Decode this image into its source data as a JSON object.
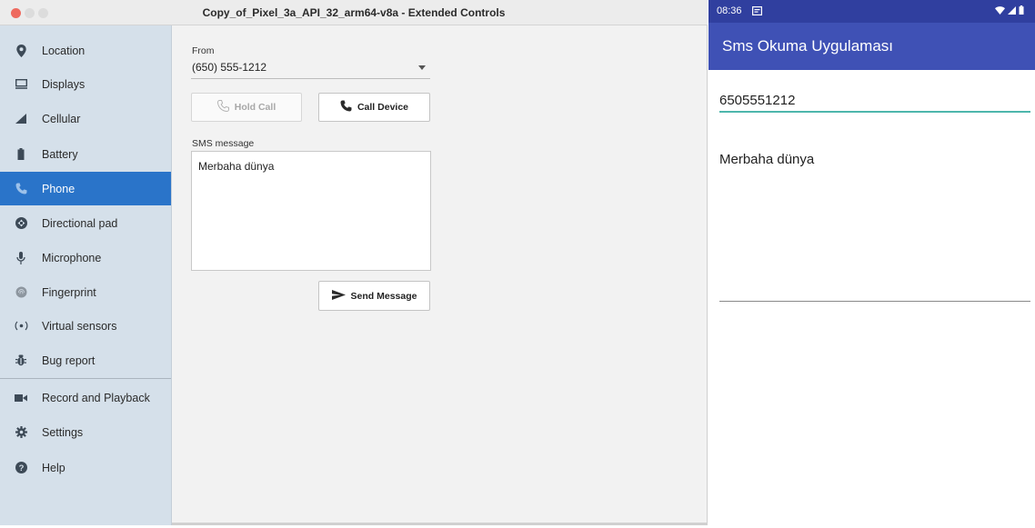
{
  "window": {
    "title": "Copy_of_Pixel_3a_API_32_arm64-v8a - Extended Controls"
  },
  "sidebar": {
    "items": [
      {
        "label": "Location",
        "icon": "location-pin-icon"
      },
      {
        "label": "Displays",
        "icon": "display-icon"
      },
      {
        "label": "Cellular",
        "icon": "cellular-signal-icon"
      },
      {
        "label": "Battery",
        "icon": "battery-icon"
      },
      {
        "label": "Phone",
        "icon": "phone-icon",
        "active": true
      },
      {
        "label": "Directional pad",
        "icon": "dpad-icon"
      },
      {
        "label": "Microphone",
        "icon": "microphone-icon"
      },
      {
        "label": "Fingerprint",
        "icon": "fingerprint-icon"
      },
      {
        "label": "Virtual sensors",
        "icon": "virtual-sensors-icon"
      },
      {
        "label": "Bug report",
        "icon": "bug-icon"
      },
      {
        "label": "Record and Playback",
        "icon": "video-camera-icon"
      },
      {
        "label": "Settings",
        "icon": "gear-icon"
      },
      {
        "label": "Help",
        "icon": "help-icon"
      }
    ]
  },
  "phone_panel": {
    "from_label": "From",
    "from_value": "(650) 555-1212",
    "hold_call_label": "Hold Call",
    "call_device_label": "Call Device",
    "sms_label": "SMS message",
    "sms_value": "Merbaha dünya",
    "send_label": "Send Message"
  },
  "device": {
    "status_time": "08:36",
    "app_title": "Sms Okuma Uygulaması",
    "phone_number": "6505551212",
    "message": "Merbaha dünya"
  },
  "colors": {
    "sidebar_active": "#2a74c9",
    "sidebar_bg": "#d5e0ea",
    "app_bar": "#3f51b5",
    "status_bar": "#303f9f",
    "field_accent": "#4db6ac"
  }
}
